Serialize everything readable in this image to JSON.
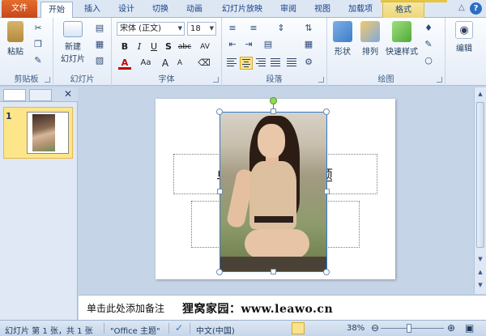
{
  "tabs": [
    "文件",
    "开始",
    "插入",
    "设计",
    "切换",
    "动画",
    "幻灯片放映",
    "审阅",
    "视图",
    "加载项",
    "格式"
  ],
  "window": {
    "help": "?"
  },
  "ribbon": {
    "clipboard": {
      "paste": "粘贴",
      "group": "剪贴板"
    },
    "slides": {
      "new_slide": "新建\n幻灯片",
      "new_slide_line1": "新建",
      "new_slide_line2": "幻灯片",
      "group": "幻灯片"
    },
    "font": {
      "font_name": "宋体 (正文)",
      "font_size": "18",
      "group": "字体",
      "bold": "B",
      "italic": "I",
      "underline": "U",
      "shadow": "S",
      "strike": "abc",
      "spacing": "AV",
      "aa": "Aa",
      "grow": "A",
      "shrink": "A"
    },
    "paragraph": {
      "group": "段落"
    },
    "drawing": {
      "shapes": "形状",
      "arrange": "排列",
      "quick_styles": "快速样式",
      "group": "绘图"
    },
    "editing": {
      "label": "编辑"
    }
  },
  "thumbnails": {
    "slide_number": "1"
  },
  "slide": {
    "title_char_left": "单",
    "title_char_right": "题"
  },
  "notes": {
    "placeholder": "单击此处添加备注",
    "watermark": "狸窝家园：www.leawo.cn"
  },
  "status": {
    "slide_info": "幻灯片 第 1 张，共 1 张",
    "theme": "\"Office 主题\"",
    "language": "中文(中国)",
    "zoom": "38%"
  },
  "colors": {
    "file_tab": "#d4572a",
    "accent": "#2e7ad1",
    "ribbon_bg": "#e4ecf7"
  }
}
